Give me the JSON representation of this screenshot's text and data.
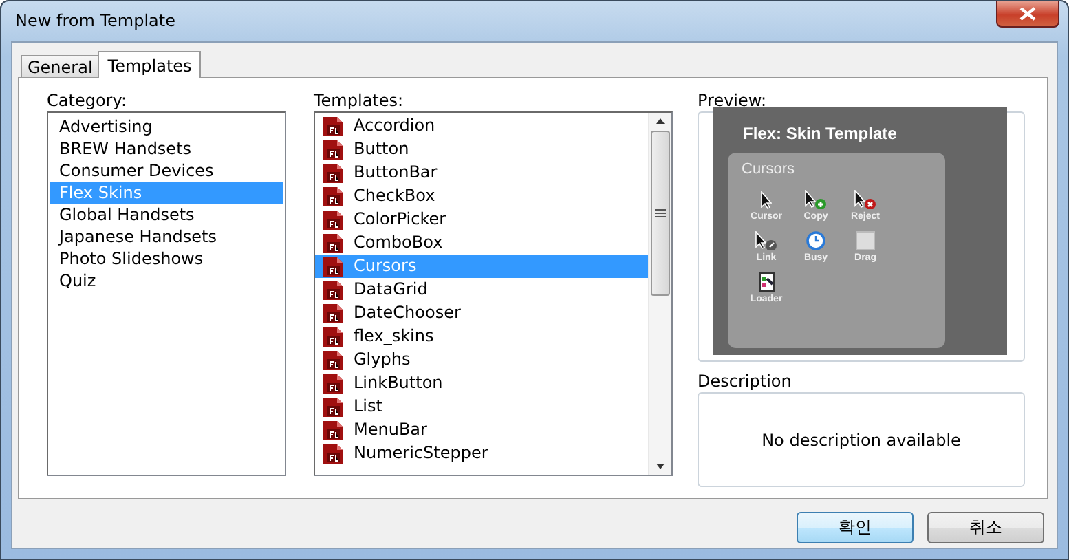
{
  "window": {
    "title": "New from Template"
  },
  "tabs": [
    {
      "label": "General",
      "selected": false
    },
    {
      "label": "Templates",
      "selected": true
    }
  ],
  "category": {
    "label": "Category:",
    "items": [
      {
        "label": "Advertising",
        "selected": false
      },
      {
        "label": "BREW Handsets",
        "selected": false
      },
      {
        "label": "Consumer Devices",
        "selected": false
      },
      {
        "label": "Flex Skins",
        "selected": true
      },
      {
        "label": "Global Handsets",
        "selected": false
      },
      {
        "label": "Japanese Handsets",
        "selected": false
      },
      {
        "label": "Photo Slideshows",
        "selected": false
      },
      {
        "label": "Quiz",
        "selected": false
      }
    ]
  },
  "templates": {
    "label": "Templates:",
    "items": [
      {
        "label": "Accordion",
        "selected": false
      },
      {
        "label": "Button",
        "selected": false
      },
      {
        "label": "ButtonBar",
        "selected": false
      },
      {
        "label": "CheckBox",
        "selected": false
      },
      {
        "label": "ColorPicker",
        "selected": false
      },
      {
        "label": "ComboBox",
        "selected": false
      },
      {
        "label": "Cursors",
        "selected": true
      },
      {
        "label": "DataGrid",
        "selected": false
      },
      {
        "label": "DateChooser",
        "selected": false
      },
      {
        "label": "flex_skins",
        "selected": false
      },
      {
        "label": "Glyphs",
        "selected": false
      },
      {
        "label": "LinkButton",
        "selected": false
      },
      {
        "label": "List",
        "selected": false
      },
      {
        "label": "MenuBar",
        "selected": false
      },
      {
        "label": "NumericStepper",
        "selected": false
      }
    ]
  },
  "preview": {
    "label": "Preview:",
    "title": "Flex: Skin Template",
    "section": "Cursors",
    "cursors": [
      {
        "label": "Cursor",
        "kind": "arrow"
      },
      {
        "label": "Copy",
        "kind": "copy"
      },
      {
        "label": "Reject",
        "kind": "reject"
      },
      {
        "label": "Link",
        "kind": "link"
      },
      {
        "label": "Busy",
        "kind": "busy"
      },
      {
        "label": "Drag",
        "kind": "drag"
      },
      {
        "label": "Loader",
        "kind": "loader"
      }
    ]
  },
  "description": {
    "label": "Description",
    "text": "No description available"
  },
  "buttons": [
    {
      "label": "확인",
      "default": true
    },
    {
      "label": "취소",
      "default": false
    }
  ]
}
